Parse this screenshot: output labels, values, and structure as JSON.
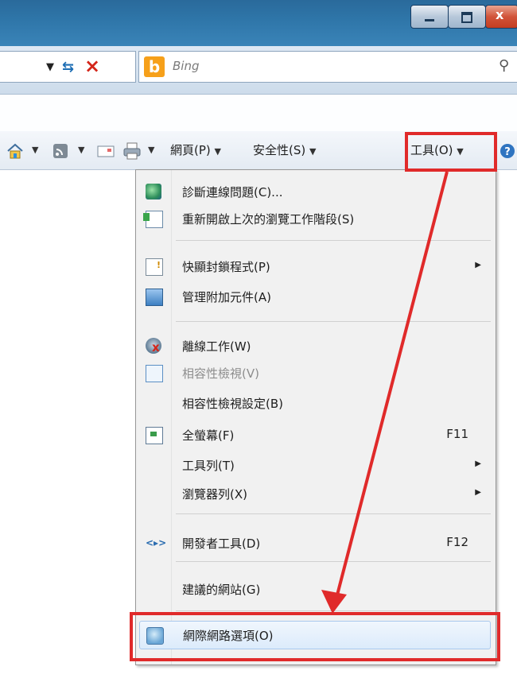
{
  "window": {
    "controls": [
      "minimize-icon",
      "maximize-icon",
      "close-icon"
    ]
  },
  "address_bar": {
    "search_placeholder": "Bing"
  },
  "command_bar": {
    "items": [
      {
        "name": "home",
        "icon": "home-icon"
      },
      {
        "name": "feeds",
        "icon": "rss-icon"
      },
      {
        "name": "read-mail",
        "icon": "mail-icon"
      },
      {
        "name": "print",
        "icon": "print-icon"
      },
      {
        "name": "page",
        "label": "網頁(P)"
      },
      {
        "name": "safety",
        "label": "安全性(S)"
      },
      {
        "name": "tools",
        "label": "工具(O)"
      },
      {
        "name": "help",
        "icon": "help-icon"
      }
    ]
  },
  "tools_menu": {
    "items": [
      {
        "label": "診斷連線問題(C)...",
        "icon": "diagnose-icon"
      },
      {
        "label": "重新開啟上次的瀏覽工作階段(S)",
        "icon": "reopen-session-icon"
      },
      {
        "label": "快顯封鎖程式(P)",
        "icon": "popup-blocker-icon",
        "submenu": true
      },
      {
        "label": "管理附加元件(A)",
        "icon": "manage-addons-icon"
      },
      {
        "label": "離線工作(W)",
        "icon": "offline-icon"
      },
      {
        "label": "相容性檢視(V)",
        "icon": "compat-view-icon",
        "disabled": true
      },
      {
        "label": "相容性檢視設定(B)"
      },
      {
        "label": "全螢幕(F)",
        "icon": "fullscreen-icon",
        "shortcut": "F11"
      },
      {
        "label": "工具列(T)",
        "submenu": true
      },
      {
        "label": "瀏覽器列(X)",
        "submenu": true
      },
      {
        "label": "開發者工具(D)",
        "icon": "developer-tools-icon",
        "shortcut": "F12"
      },
      {
        "label": "建議的網站(G)"
      },
      {
        "label": "網際網路選項(O)",
        "icon": "internet-options-icon",
        "highlighted": true
      }
    ]
  },
  "annotation": {
    "color": "#e02a2a"
  }
}
